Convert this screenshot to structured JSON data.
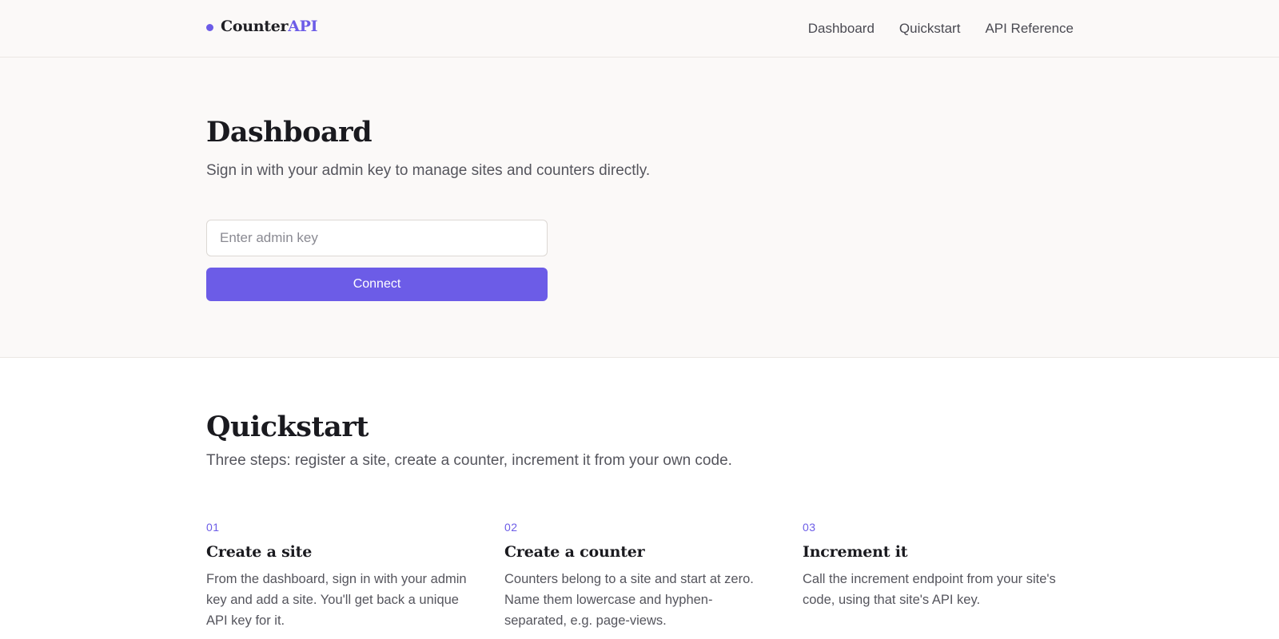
{
  "header": {
    "logo_main": "Counter",
    "logo_accent": "API",
    "nav": [
      "Dashboard",
      "Quickstart",
      "API Reference"
    ]
  },
  "dashboard": {
    "title": "Dashboard",
    "subtitle": "Sign in with your admin key to manage sites and counters directly.",
    "admin_key_placeholder": "Enter admin key",
    "admin_key_value": "",
    "connect_label": "Connect"
  },
  "quickstart": {
    "title": "Quickstart",
    "subtitle": "Three steps: register a site, create a counter, increment it from your own code.",
    "steps": [
      {
        "num": "01",
        "title": "Create a site",
        "body": "From the dashboard, sign in with your admin key and add a site. You'll get back a unique API key for it."
      },
      {
        "num": "02",
        "title": "Create a counter",
        "body": "Counters belong to a site and start at zero. Name them lowercase and hyphen-separated, e.g. page-views."
      },
      {
        "num": "03",
        "title": "Increment it",
        "body": "Call the increment endpoint from your site's code, using that site's API key."
      }
    ]
  },
  "colors": {
    "accent": "#6c5ce7",
    "hero_background": "#fbf9f8",
    "text": "#1f1f24",
    "muted": "#55555d"
  },
  "icons": [
    "logo-dot-icon"
  ]
}
